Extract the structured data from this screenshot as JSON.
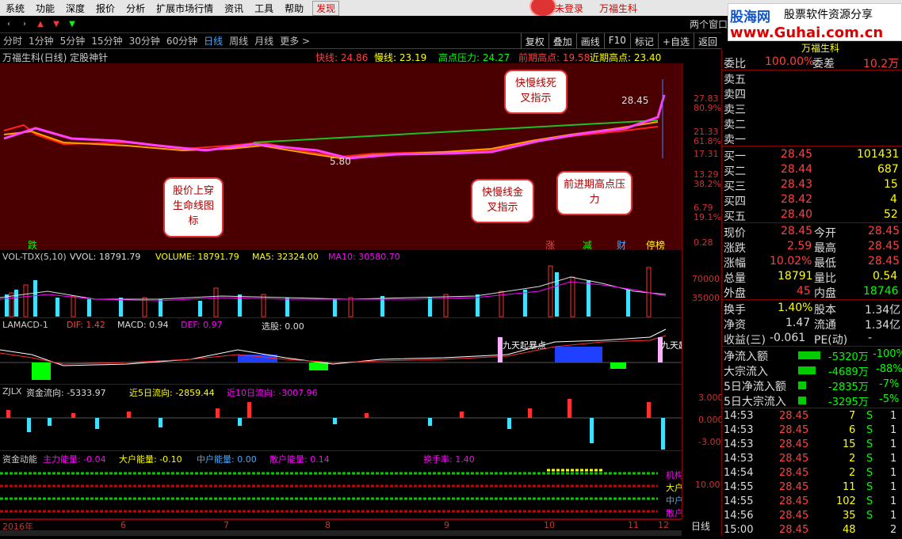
{
  "menu": {
    "items": [
      "系统",
      "功能",
      "深度",
      "报价",
      "分析",
      "扩展市场行情",
      "资讯",
      "工具",
      "帮助"
    ],
    "find": "发现",
    "login": "未登录",
    "stock_title": "万福生科"
  },
  "watermark": {
    "site": "股海网",
    "slogan": "股票软件资源分享",
    "url": "www.Guhai.com.cn"
  },
  "window": {
    "two_windows": "两个窗口"
  },
  "periods": [
    "分时",
    "1分钟",
    "5分钟",
    "15分钟",
    "30分钟",
    "60分钟",
    "日线",
    "周线",
    "月线",
    "更多 >"
  ],
  "active_period": "日线",
  "toolbar_right": [
    "复权",
    "叠加",
    "画线",
    "F10",
    "标记",
    "+自选",
    "返回"
  ],
  "chart_header": {
    "title": "万福生科(日线) 定股神针",
    "fast": "快线: 24.86",
    "slow": "慢线: 23.19",
    "high_pressure": "高点压力: 24.27",
    "prev_high": "前期高点: 19.58",
    "near_high": "近期高点: 23.40"
  },
  "main_scale": [
    "27.83",
    "80.9%",
    "21.33",
    "61.8%",
    "17.31",
    "13.29",
    "38.2%",
    "6.79",
    "19.1%",
    "0.28"
  ],
  "price_labels": {
    "p1": "28.45",
    "p2": "5.80"
  },
  "signals": {
    "die": "跌",
    "zhang": "涨",
    "jian": "减",
    "cai": "财",
    "ting": "停榜"
  },
  "callouts": {
    "c1": "快慢线死叉指示",
    "c2": "股价上穿生命线图标",
    "c3": "快慢线金叉指示",
    "c4": "前进期高点压力"
  },
  "vol": {
    "name": "VOL-TDX(5,10)",
    "vvol": "VVOL: 18791.79",
    "volume": "VOLUME: 18791.79",
    "ma5": "MA5: 32324.00",
    "ma10": "MA10: 30580.70",
    "scale": [
      "70000",
      "35000"
    ]
  },
  "macd": {
    "name": "LAMACD-1",
    "dif": "DIF: 1.42",
    "macd": "MACD: 0.94",
    "def": "DEF: 0.97",
    "pick": "选股: 0.00",
    "label": "九天起暴点",
    "label2": "九天起"
  },
  "zjlx": {
    "name": "ZJLX",
    "flow": "资金流向: -5333.97",
    "flow5": "近5日流向: -2859.44",
    "flow10": "近10日流向: -3007.96",
    "scale": [
      "3.000",
      "0.000",
      "-3.000"
    ]
  },
  "zjdn": {
    "name": "资金动能",
    "main": "主力能量: -0.04",
    "big": "大户能量: -0.10",
    "mid": "中户能量: 0.00",
    "retail": "散户能量: 0.14",
    "turnover": "换手率: 1.40",
    "scale": "10.00",
    "tags": [
      "机构",
      "大户",
      "中户",
      "散户"
    ]
  },
  "dates": [
    "2016年",
    "6",
    "7",
    "8",
    "9",
    "10",
    "11",
    "12"
  ],
  "day_label": "日线",
  "right": {
    "header_name": "万福生科",
    "weibi": "委比",
    "weibi_v": "100.00%",
    "weicha": "委差",
    "weicha_v": "10.2万",
    "sell": [
      "卖五",
      "卖四",
      "卖三",
      "卖二",
      "卖一"
    ],
    "buy": [
      {
        "l": "买一",
        "p": "28.45",
        "v": "101431"
      },
      {
        "l": "买二",
        "p": "28.44",
        "v": "687"
      },
      {
        "l": "买三",
        "p": "28.43",
        "v": "15"
      },
      {
        "l": "买四",
        "p": "28.42",
        "v": "4"
      },
      {
        "l": "买五",
        "p": "28.40",
        "v": "52"
      }
    ],
    "stats": [
      {
        "a": "现价",
        "av": "28.45",
        "b": "今开",
        "bv": "28.45"
      },
      {
        "a": "涨跌",
        "av": "2.59",
        "b": "最高",
        "bv": "28.45"
      },
      {
        "a": "涨幅",
        "av": "10.02%",
        "b": "最低",
        "bv": "28.45"
      },
      {
        "a": "总量",
        "av": "18791",
        "b": "量比",
        "bv": "0.54"
      },
      {
        "a": "外盘",
        "av": "45",
        "b": "内盘",
        "bv": "18746"
      }
    ],
    "stats2": [
      {
        "a": "换手",
        "av": "1.40%",
        "b": "股本",
        "bv": "1.34亿"
      },
      {
        "a": "净资",
        "av": "1.47",
        "b": "流通",
        "bv": "1.34亿"
      },
      {
        "a": "收益(三)",
        "av": "-0.061",
        "b": "PE(动)",
        "bv": "-"
      }
    ],
    "flows": [
      {
        "l": "净流入额",
        "v": "-5320万",
        "p": "-100%"
      },
      {
        "l": "大宗流入",
        "v": "-4689万",
        "p": "-88%"
      },
      {
        "l": "5日净流入额",
        "v": "-2835万",
        "p": "-7%"
      },
      {
        "l": "5日大宗流入",
        "v": "-3295万",
        "p": "-5%"
      }
    ],
    "ticks": [
      {
        "t": "14:53",
        "p": "28.45",
        "v": "7",
        "s": "S",
        "n": "1"
      },
      {
        "t": "14:53",
        "p": "28.45",
        "v": "6",
        "s": "S",
        "n": "1"
      },
      {
        "t": "14:53",
        "p": "28.45",
        "v": "15",
        "s": "S",
        "n": "1"
      },
      {
        "t": "14:53",
        "p": "28.45",
        "v": "2",
        "s": "S",
        "n": "1"
      },
      {
        "t": "14:54",
        "p": "28.45",
        "v": "2",
        "s": "S",
        "n": "1"
      },
      {
        "t": "14:55",
        "p": "28.45",
        "v": "11",
        "s": "S",
        "n": "1"
      },
      {
        "t": "14:55",
        "p": "28.45",
        "v": "102",
        "s": "S",
        "n": "1"
      },
      {
        "t": "14:56",
        "p": "28.45",
        "v": "35",
        "s": "S",
        "n": "1"
      },
      {
        "t": "15:00",
        "p": "28.45",
        "v": "48",
        "s": "",
        "n": "2"
      }
    ]
  }
}
